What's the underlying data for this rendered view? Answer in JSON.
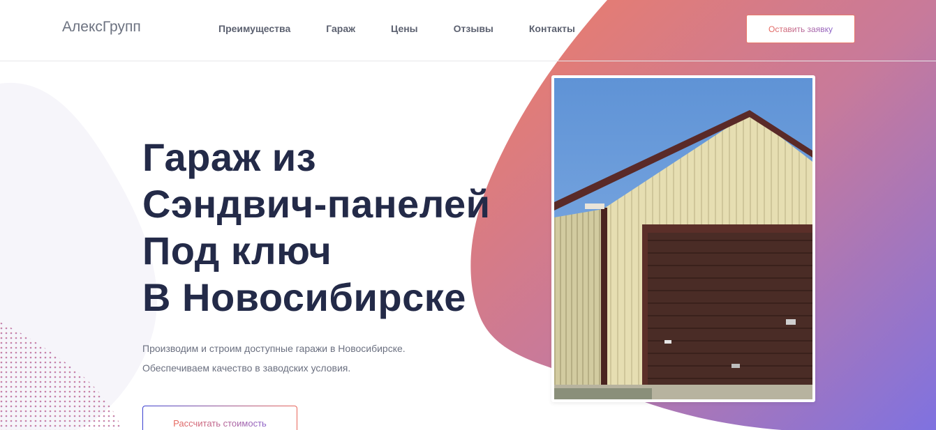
{
  "brand": {
    "logo": "АлексГрупп"
  },
  "nav": {
    "items": [
      "Преимущества",
      "Гараж",
      "Цены",
      "Отзывы",
      "Контакты"
    ]
  },
  "header": {
    "cta_label": "Оставить заявку"
  },
  "hero": {
    "title_lines": [
      "Гараж из",
      "Сэндвич-панелей",
      "Под ключ",
      "В Новосибирске"
    ],
    "description": [
      "Производим и строим доступные гаражи в Новосибирске.",
      "Обеспечиваем качество в заводских условия."
    ],
    "cta_label": "Рассчитать стоимость"
  },
  "colors": {
    "gradient_start": "#e8796a",
    "gradient_end": "#8a6fd8",
    "heading": "#232a48",
    "text": "#6b7080"
  },
  "icons": {
    "photo": "garage-photo"
  }
}
